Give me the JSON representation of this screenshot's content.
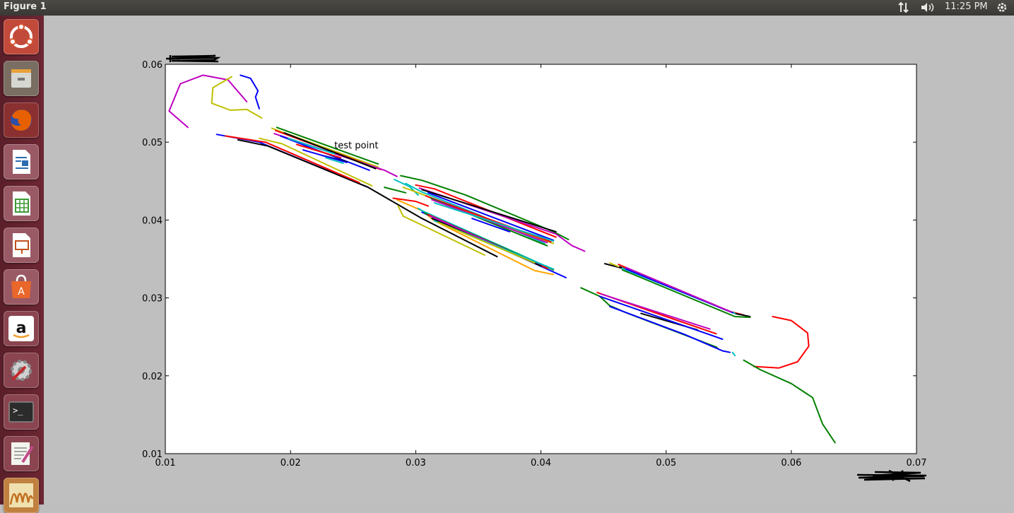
{
  "topbar": {
    "window_title": "Figure 1",
    "clock": "11:25 PM",
    "icons": [
      "network-updown-icon",
      "volume-icon",
      "power-gear-icon"
    ]
  },
  "launcher": {
    "items": [
      {
        "name": "ubuntu-dash-icon",
        "color": "#d65532"
      },
      {
        "name": "files-icon",
        "color": "#9a9a96"
      },
      {
        "name": "firefox-icon",
        "color": "#e66000"
      },
      {
        "name": "libreoffice-writer-icon",
        "color": "#2a6bb1"
      },
      {
        "name": "libreoffice-calc-icon",
        "color": "#3e9a35"
      },
      {
        "name": "libreoffice-impress-icon",
        "color": "#c1501f"
      },
      {
        "name": "ubuntu-software-icon",
        "color": "#e9672a"
      },
      {
        "name": "amazon-icon",
        "color": "#ffffff"
      },
      {
        "name": "system-settings-icon",
        "color": "#8a8a8a"
      },
      {
        "name": "terminal-icon",
        "color": "#2c2c2c"
      },
      {
        "name": "text-editor-icon",
        "color": "#d8d8d0"
      },
      {
        "name": "matplotlib-figure-icon",
        "color": "#d8a040"
      }
    ]
  },
  "chart_data": {
    "type": "line",
    "title": "",
    "xlabel": "",
    "ylabel": "",
    "xlim": [
      0.01,
      0.07
    ],
    "ylim": [
      0.01,
      0.06
    ],
    "xticks": [
      "0.01",
      "0.02",
      "0.03",
      "0.04",
      "0.05",
      "0.06",
      "0.07"
    ],
    "yticks": [
      "0.01",
      "0.02",
      "0.03",
      "0.04",
      "0.05",
      "0.06"
    ],
    "grid": false,
    "annotations": [
      {
        "text": "test point",
        "x": 0.0235,
        "y": 0.0492
      }
    ],
    "colors": [
      "#0000ff",
      "#008000",
      "#ff0000",
      "#00bfbf",
      "#bf00bf",
      "#bfbf00",
      "#000000",
      "#ffa500"
    ],
    "series": [
      {
        "color": "#bf00bf",
        "points": [
          [
            0.0118,
            0.0519
          ],
          [
            0.0103,
            0.054
          ],
          [
            0.0112,
            0.0575
          ],
          [
            0.013,
            0.0586
          ],
          [
            0.015,
            0.058
          ],
          [
            0.0165,
            0.0552
          ]
        ]
      },
      {
        "color": "#bfbf00",
        "points": [
          [
            0.0153,
            0.0584
          ],
          [
            0.0138,
            0.057
          ],
          [
            0.0137,
            0.055
          ],
          [
            0.0152,
            0.0541
          ],
          [
            0.0165,
            0.0542
          ],
          [
            0.0177,
            0.0531
          ]
        ]
      },
      {
        "color": "#0000ff",
        "points": [
          [
            0.016,
            0.0586
          ],
          [
            0.0168,
            0.0582
          ],
          [
            0.0174,
            0.0566
          ],
          [
            0.0172,
            0.0558
          ],
          [
            0.0175,
            0.0543
          ]
        ]
      },
      {
        "color": "#0000ff",
        "points": [
          [
            0.0141,
            0.051
          ],
          [
            0.0175,
            0.05
          ],
          [
            0.0262,
            0.0442
          ]
        ]
      },
      {
        "color": "#000000",
        "points": [
          [
            0.0158,
            0.0503
          ],
          [
            0.0182,
            0.0495
          ],
          [
            0.0262,
            0.0442
          ],
          [
            0.0305,
            0.0402
          ],
          [
            0.0365,
            0.0353
          ]
        ]
      },
      {
        "color": "#bfbf00",
        "points": [
          [
            0.0175,
            0.0505
          ],
          [
            0.0193,
            0.0498
          ],
          [
            0.0265,
            0.0444
          ]
        ]
      },
      {
        "color": "#ff0000",
        "points": [
          [
            0.0148,
            0.0508
          ],
          [
            0.018,
            0.05
          ],
          [
            0.0255,
            0.0448
          ]
        ]
      },
      {
        "color": "#bfbf00",
        "points": [
          [
            0.0185,
            0.0518
          ],
          [
            0.027,
            0.0468
          ]
        ]
      },
      {
        "color": "#ff0000",
        "points": [
          [
            0.0188,
            0.0515
          ],
          [
            0.0272,
            0.0465
          ]
        ]
      },
      {
        "color": "#bf00bf",
        "points": [
          [
            0.0187,
            0.0511
          ],
          [
            0.0275,
            0.0464
          ],
          [
            0.0285,
            0.0456
          ]
        ]
      },
      {
        "color": "#000000",
        "points": [
          [
            0.0195,
            0.0512
          ],
          [
            0.0268,
            0.0466
          ]
        ]
      },
      {
        "color": "#0000ff",
        "points": [
          [
            0.0192,
            0.0508
          ],
          [
            0.0263,
            0.0464
          ]
        ]
      },
      {
        "color": "#008000",
        "points": [
          [
            0.0189,
            0.0519
          ],
          [
            0.027,
            0.0472
          ]
        ]
      },
      {
        "color": "#00bfbf",
        "points": [
          [
            0.0198,
            0.0505
          ],
          [
            0.0235,
            0.0485
          ]
        ]
      },
      {
        "color": "#000000",
        "points": [
          [
            0.0225,
            0.0483
          ],
          [
            0.0245,
            0.0475
          ]
        ]
      },
      {
        "color": "#ff0000",
        "points": [
          [
            0.0205,
            0.0497
          ],
          [
            0.024,
            0.048
          ]
        ]
      },
      {
        "color": "#0000ff",
        "points": [
          [
            0.021,
            0.049
          ],
          [
            0.0245,
            0.0474
          ]
        ]
      },
      {
        "color": "#00bfbf",
        "points": [
          [
            0.0228,
            0.048
          ],
          [
            0.0242,
            0.0473
          ]
        ]
      },
      {
        "color": "#008000",
        "points": [
          [
            0.0275,
            0.0442
          ],
          [
            0.0292,
            0.0435
          ]
        ]
      },
      {
        "color": "#008000",
        "points": [
          [
            0.0288,
            0.0457
          ],
          [
            0.0305,
            0.0451
          ],
          [
            0.034,
            0.0432
          ],
          [
            0.041,
            0.0385
          ],
          [
            0.0422,
            0.0375
          ]
        ]
      },
      {
        "color": "#00bfbf",
        "points": [
          [
            0.0283,
            0.0452
          ],
          [
            0.0295,
            0.0443
          ],
          [
            0.0302,
            0.0432
          ]
        ]
      },
      {
        "color": "#00bfbf",
        "points": [
          [
            0.0292,
            0.0447
          ],
          [
            0.0305,
            0.0436
          ],
          [
            0.035,
            0.0407
          ],
          [
            0.0403,
            0.037
          ]
        ]
      },
      {
        "color": "#bfbf00",
        "points": [
          [
            0.029,
            0.0442
          ],
          [
            0.0302,
            0.0435
          ],
          [
            0.037,
            0.0393
          ],
          [
            0.041,
            0.037
          ]
        ]
      },
      {
        "color": "#ff0000",
        "points": [
          [
            0.03,
            0.0445
          ],
          [
            0.0315,
            0.044
          ],
          [
            0.0412,
            0.0378
          ]
        ]
      },
      {
        "color": "#bf00bf",
        "points": [
          [
            0.0303,
            0.0441
          ],
          [
            0.0412,
            0.0382
          ],
          [
            0.0425,
            0.0367
          ],
          [
            0.0435,
            0.036
          ]
        ]
      },
      {
        "color": "#000000",
        "points": [
          [
            0.0305,
            0.0439
          ],
          [
            0.0412,
            0.0385
          ]
        ]
      },
      {
        "color": "#0000ff",
        "points": [
          [
            0.031,
            0.0435
          ],
          [
            0.041,
            0.0374
          ]
        ]
      },
      {
        "color": "#ff0000",
        "points": [
          [
            0.0308,
            0.0431
          ],
          [
            0.0408,
            0.0372
          ]
        ]
      },
      {
        "color": "#008000",
        "points": [
          [
            0.0312,
            0.0428
          ],
          [
            0.0405,
            0.0367
          ]
        ]
      },
      {
        "color": "#bf00bf",
        "points": [
          [
            0.0313,
            0.0426
          ],
          [
            0.0405,
            0.0371
          ]
        ]
      },
      {
        "color": "#00bfbf",
        "points": [
          [
            0.0315,
            0.0422
          ],
          [
            0.041,
            0.0373
          ]
        ]
      },
      {
        "color": "#0000ff",
        "points": [
          [
            0.0345,
            0.0402
          ],
          [
            0.0375,
            0.0385
          ]
        ]
      },
      {
        "color": "#ffa500",
        "points": [
          [
            0.0285,
            0.0426
          ],
          [
            0.0305,
            0.0412
          ],
          [
            0.0315,
            0.0399
          ],
          [
            0.0395,
            0.0335
          ],
          [
            0.041,
            0.033
          ]
        ]
      },
      {
        "color": "#ff0000",
        "points": [
          [
            0.0282,
            0.0428
          ],
          [
            0.03,
            0.0424
          ],
          [
            0.031,
            0.0418
          ]
        ]
      },
      {
        "color": "#bfbf00",
        "points": [
          [
            0.0286,
            0.0418
          ],
          [
            0.029,
            0.0405
          ],
          [
            0.0355,
            0.0355
          ]
        ]
      },
      {
        "color": "#00bfbf",
        "points": [
          [
            0.0302,
            0.0415
          ],
          [
            0.0305,
            0.0412
          ],
          [
            0.0405,
            0.034
          ]
        ]
      },
      {
        "color": "#0000ff",
        "points": [
          [
            0.0305,
            0.041
          ],
          [
            0.042,
            0.0326
          ]
        ]
      },
      {
        "color": "#008000",
        "points": [
          [
            0.0307,
            0.0409
          ],
          [
            0.041,
            0.0336
          ]
        ]
      },
      {
        "color": "#ff0000",
        "points": [
          [
            0.031,
            0.0407
          ],
          [
            0.0405,
            0.0338
          ]
        ]
      },
      {
        "color": "#bf00bf",
        "points": [
          [
            0.0312,
            0.0405
          ],
          [
            0.04,
            0.0342
          ]
        ]
      },
      {
        "color": "#000000",
        "points": [
          [
            0.0313,
            0.0402
          ],
          [
            0.04,
            0.0341
          ]
        ]
      },
      {
        "color": "#00bfbf",
        "points": [
          [
            0.0315,
            0.0399
          ],
          [
            0.041,
            0.0337
          ]
        ]
      },
      {
        "color": "#bfbf00",
        "points": [
          [
            0.0318,
            0.0397
          ],
          [
            0.0395,
            0.0345
          ]
        ]
      },
      {
        "color": "#008000",
        "points": [
          [
            0.0432,
            0.0313
          ],
          [
            0.0447,
            0.0302
          ],
          [
            0.0455,
            0.029
          ],
          [
            0.0468,
            0.0281
          ],
          [
            0.054,
            0.0237
          ],
          [
            0.0542,
            0.0234
          ]
        ]
      },
      {
        "color": "#0000ff",
        "points": [
          [
            0.0455,
            0.0289
          ],
          [
            0.0515,
            0.0253
          ],
          [
            0.0545,
            0.0232
          ],
          [
            0.0551,
            0.023
          ]
        ]
      },
      {
        "color": "#00bfbf",
        "points": [
          [
            0.0553,
            0.023
          ],
          [
            0.0555,
            0.0226
          ]
        ]
      },
      {
        "color": "#ff0000",
        "points": [
          [
            0.0445,
            0.0307
          ],
          [
            0.05,
            0.0276
          ],
          [
            0.054,
            0.0254
          ]
        ]
      },
      {
        "color": "#bf00bf",
        "points": [
          [
            0.0448,
            0.0305
          ],
          [
            0.0535,
            0.026
          ]
        ]
      },
      {
        "color": "#000000",
        "points": [
          [
            0.048,
            0.028
          ],
          [
            0.0525,
            0.0259
          ]
        ]
      },
      {
        "color": "#0000ff",
        "points": [
          [
            0.0447,
            0.0302
          ],
          [
            0.0545,
            0.0247
          ]
        ]
      },
      {
        "color": "#000000",
        "points": [
          [
            0.0451,
            0.0344
          ],
          [
            0.0465,
            0.0338
          ]
        ]
      },
      {
        "color": "#bfbf00",
        "points": [
          [
            0.0455,
            0.0345
          ],
          [
            0.0462,
            0.034
          ]
        ]
      },
      {
        "color": "#ff0000",
        "points": [
          [
            0.0462,
            0.0343
          ],
          [
            0.055,
            0.0283
          ],
          [
            0.0562,
            0.0278
          ]
        ]
      },
      {
        "color": "#000000",
        "points": [
          [
            0.0463,
            0.034
          ],
          [
            0.0555,
            0.028
          ],
          [
            0.0567,
            0.0276
          ]
        ]
      },
      {
        "color": "#008000",
        "points": [
          [
            0.0465,
            0.0336
          ],
          [
            0.0555,
            0.0276
          ],
          [
            0.0567,
            0.0275
          ]
        ]
      },
      {
        "color": "#00bfbf",
        "points": [
          [
            0.0465,
            0.0338
          ],
          [
            0.0555,
            0.028
          ]
        ]
      },
      {
        "color": "#0000ff",
        "points": [
          [
            0.0468,
            0.0337
          ],
          [
            0.0553,
            0.0281
          ]
        ]
      },
      {
        "color": "#bf00bf",
        "points": [
          [
            0.0468,
            0.0339
          ],
          [
            0.0552,
            0.0282
          ]
        ]
      },
      {
        "color": "#ff0000",
        "points": [
          [
            0.0585,
            0.0276
          ],
          [
            0.06,
            0.0271
          ],
          [
            0.0613,
            0.0255
          ],
          [
            0.0614,
            0.0238
          ],
          [
            0.0605,
            0.0218
          ],
          [
            0.059,
            0.021
          ],
          [
            0.057,
            0.0212
          ]
        ]
      },
      {
        "color": "#008000",
        "points": [
          [
            0.0562,
            0.022
          ],
          [
            0.0575,
            0.0208
          ],
          [
            0.06,
            0.019
          ],
          [
            0.0617,
            0.0172
          ],
          [
            0.0625,
            0.0138
          ],
          [
            0.0635,
            0.0114
          ]
        ]
      }
    ]
  }
}
